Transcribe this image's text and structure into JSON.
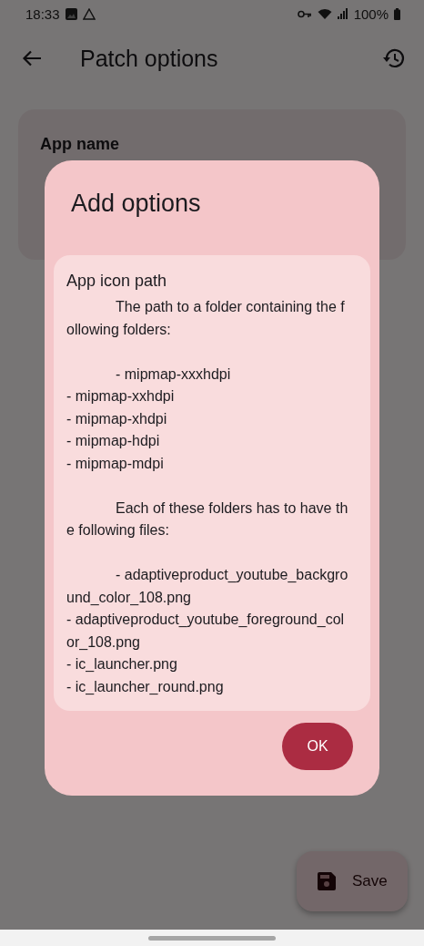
{
  "status_bar": {
    "time": "18:33",
    "battery": "100%"
  },
  "top_bar": {
    "title": "Patch options"
  },
  "option_card": {
    "title": "App name"
  },
  "save_button": {
    "label": "Save"
  },
  "dialog": {
    "title": "Add options",
    "option": {
      "title": "App icon path",
      "description": "\tThe path to a folder containing the following folders:\n\n\t- mipmap-xxxhdpi\n- mipmap-xxhdpi\n- mipmap-xhdpi\n- mipmap-hdpi\n- mipmap-mdpi\n\n\tEach of these folders has to have the following files:\n\n\t- adaptiveproduct_youtube_background_color_108.png\n- adaptiveproduct_youtube_foreground_color_108.png\n- ic_launcher.png\n- ic_launcher_round.png"
    },
    "confirm": "OK"
  }
}
